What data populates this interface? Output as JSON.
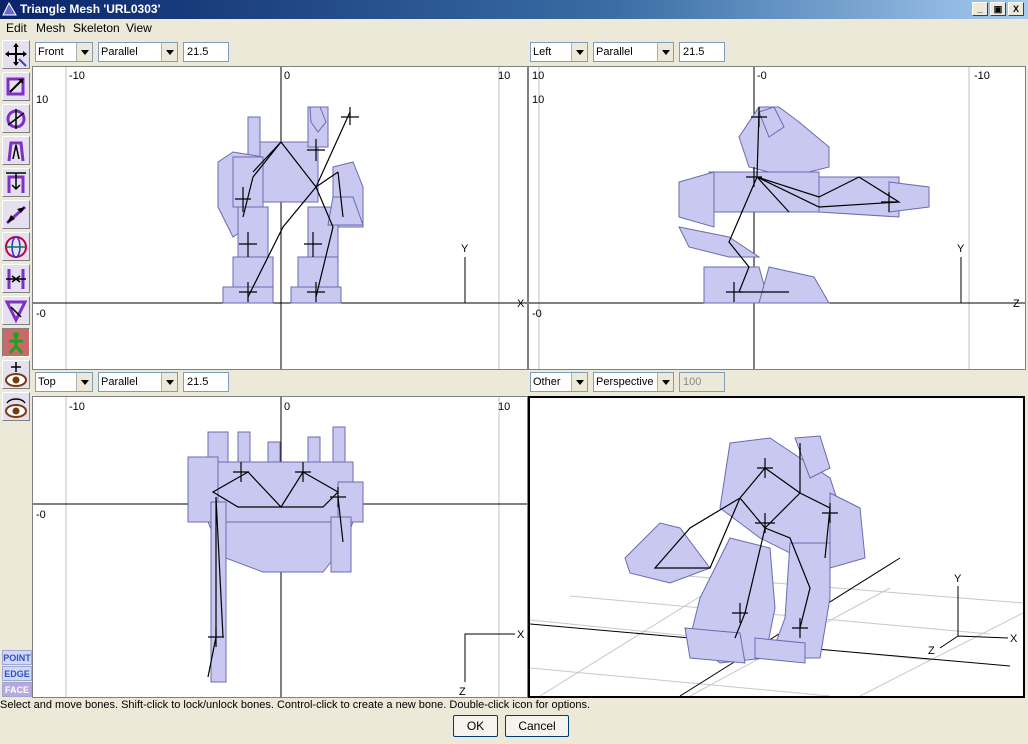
{
  "window": {
    "title": "Triangle Mesh 'URL0303'",
    "controls": [
      "_",
      "▣",
      "X"
    ]
  },
  "menu": [
    "Edit",
    "Mesh",
    "Skeleton",
    "View"
  ],
  "toolbox": {
    "tools": [
      "move-tool",
      "scale-tool",
      "rotate-tool",
      "bend-tool",
      "squeeze-tool",
      "stretch-tool",
      "sphere-tool",
      "align-tool",
      "skew-tool",
      "bones-tool",
      "pan-view-tool",
      "orbit-view-tool"
    ],
    "modes": [
      "POINT",
      "EDGE",
      "FACE"
    ]
  },
  "viewports": [
    {
      "view": "Front",
      "projection": "Parallel",
      "zoom": "21.5",
      "ticks": {
        "left": "-10",
        "center": "0",
        "right": "10",
        "top": "10",
        "bottom": "-0"
      },
      "axes": {
        "up": "Y",
        "side": "X"
      }
    },
    {
      "view": "Left",
      "projection": "Parallel",
      "zoom": "21.5",
      "ticks": {
        "left": "10",
        "center": "-0",
        "right": "-10",
        "top": "10",
        "bottom": "-0"
      },
      "axes": {
        "up": "Y",
        "side": "Z"
      }
    },
    {
      "view": "Top",
      "projection": "Parallel",
      "zoom": "21.5",
      "ticks": {
        "left": "-10",
        "center": "0",
        "right": "10",
        "mid": "-0"
      },
      "axes": {
        "down": "Z",
        "side": "X"
      }
    },
    {
      "view": "Other",
      "projection": "Perspective",
      "zoom": "100",
      "axes": {
        "up": "Y",
        "side": "X",
        "depth": "Z"
      }
    }
  ],
  "status": "Select and move bones.  Shift-click to lock/unlock bones.  Control-click to create a new bone.  Double-click icon for options.",
  "buttons": {
    "ok": "OK",
    "cancel": "Cancel"
  },
  "colors": {
    "mesh_fill": "#c8c8f0",
    "mesh_stroke": "#6b6bb0",
    "bone": "#000000",
    "title_bar": "#0a246a"
  }
}
